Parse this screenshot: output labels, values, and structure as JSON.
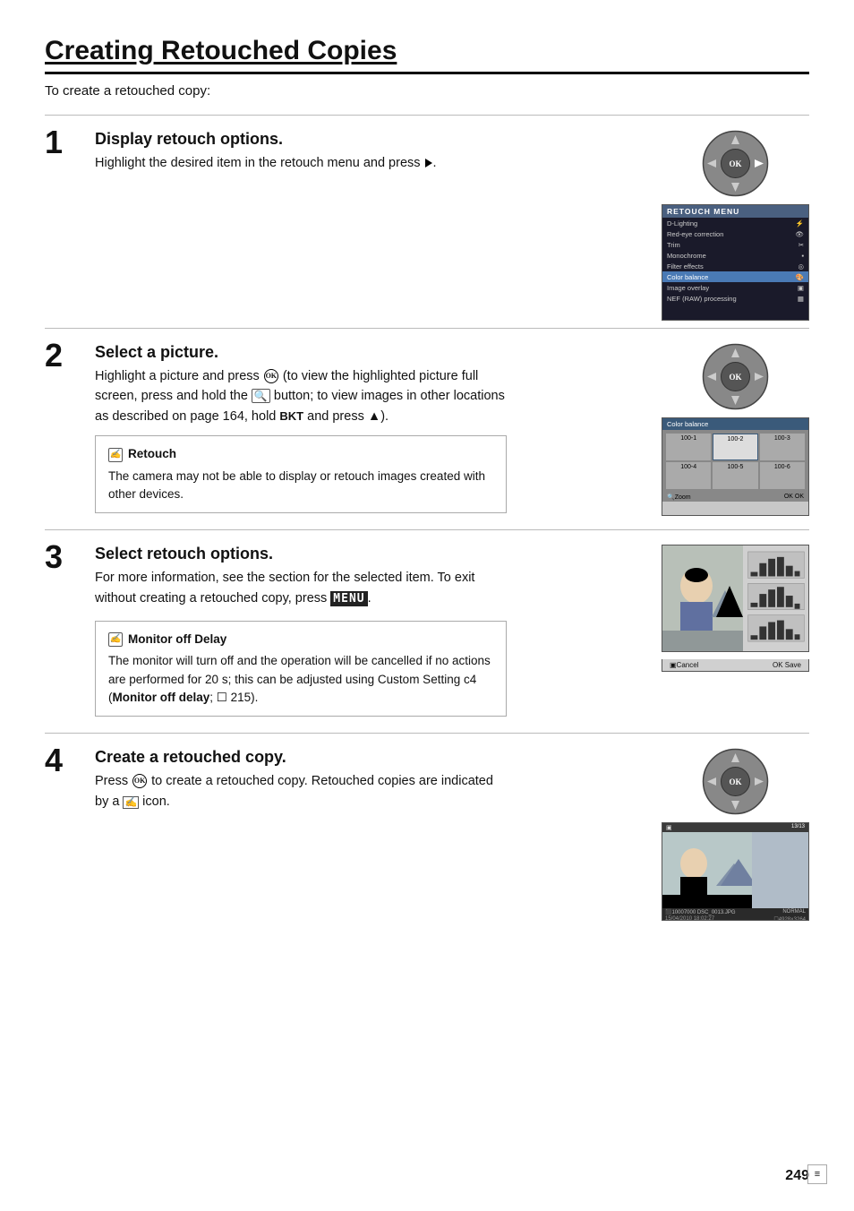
{
  "page": {
    "title": "Creating Retouched Copies",
    "intro": "To create a retouched copy:",
    "page_number": "249"
  },
  "steps": [
    {
      "number": "1",
      "title": "Display retouch options.",
      "body": "Highlight the desired item in the retouch menu and press",
      "has_arrow": true
    },
    {
      "number": "2",
      "title": "Select a picture.",
      "body_parts": [
        "Highlight a picture and press",
        " (to view the highlighted picture full screen, press and hold the",
        " button; to view images in other locations as described on page 164, hold ",
        "BKT",
        " and press ▲)."
      ]
    },
    {
      "number": "3",
      "title": "Select retouch options.",
      "body": "For more information, see the section for the selected item.  To exit without creating a retouched copy, press",
      "has_menu": true
    },
    {
      "number": "4",
      "title": "Create a retouched copy.",
      "body_parts": [
        "Press",
        " to create a retouched copy.  Retouched copies are indicated by a",
        " icon."
      ]
    }
  ],
  "notes": [
    {
      "id": "retouch",
      "title": "Retouch",
      "body": "The camera may not be able to display or retouch images created with other devices."
    },
    {
      "id": "monitor-off",
      "title": "Monitor off Delay",
      "body": "The monitor will turn off and the operation will be cancelled if no actions are performed for 20 s; this can be adjusted using Custom Setting c4 (Monitor off delay; ☐ 215)."
    }
  ],
  "retouch_menu": {
    "title": "RETOUCH MENU",
    "items": [
      "D-Lighting",
      "Red-eye correction",
      "Trim",
      "Monochrome",
      "Filter effects",
      "Color balance",
      "Image overlay",
      "NEF (RAW) processing"
    ],
    "active_index": 5
  },
  "icons": {
    "note": "✍",
    "bottom_page": "≡"
  }
}
